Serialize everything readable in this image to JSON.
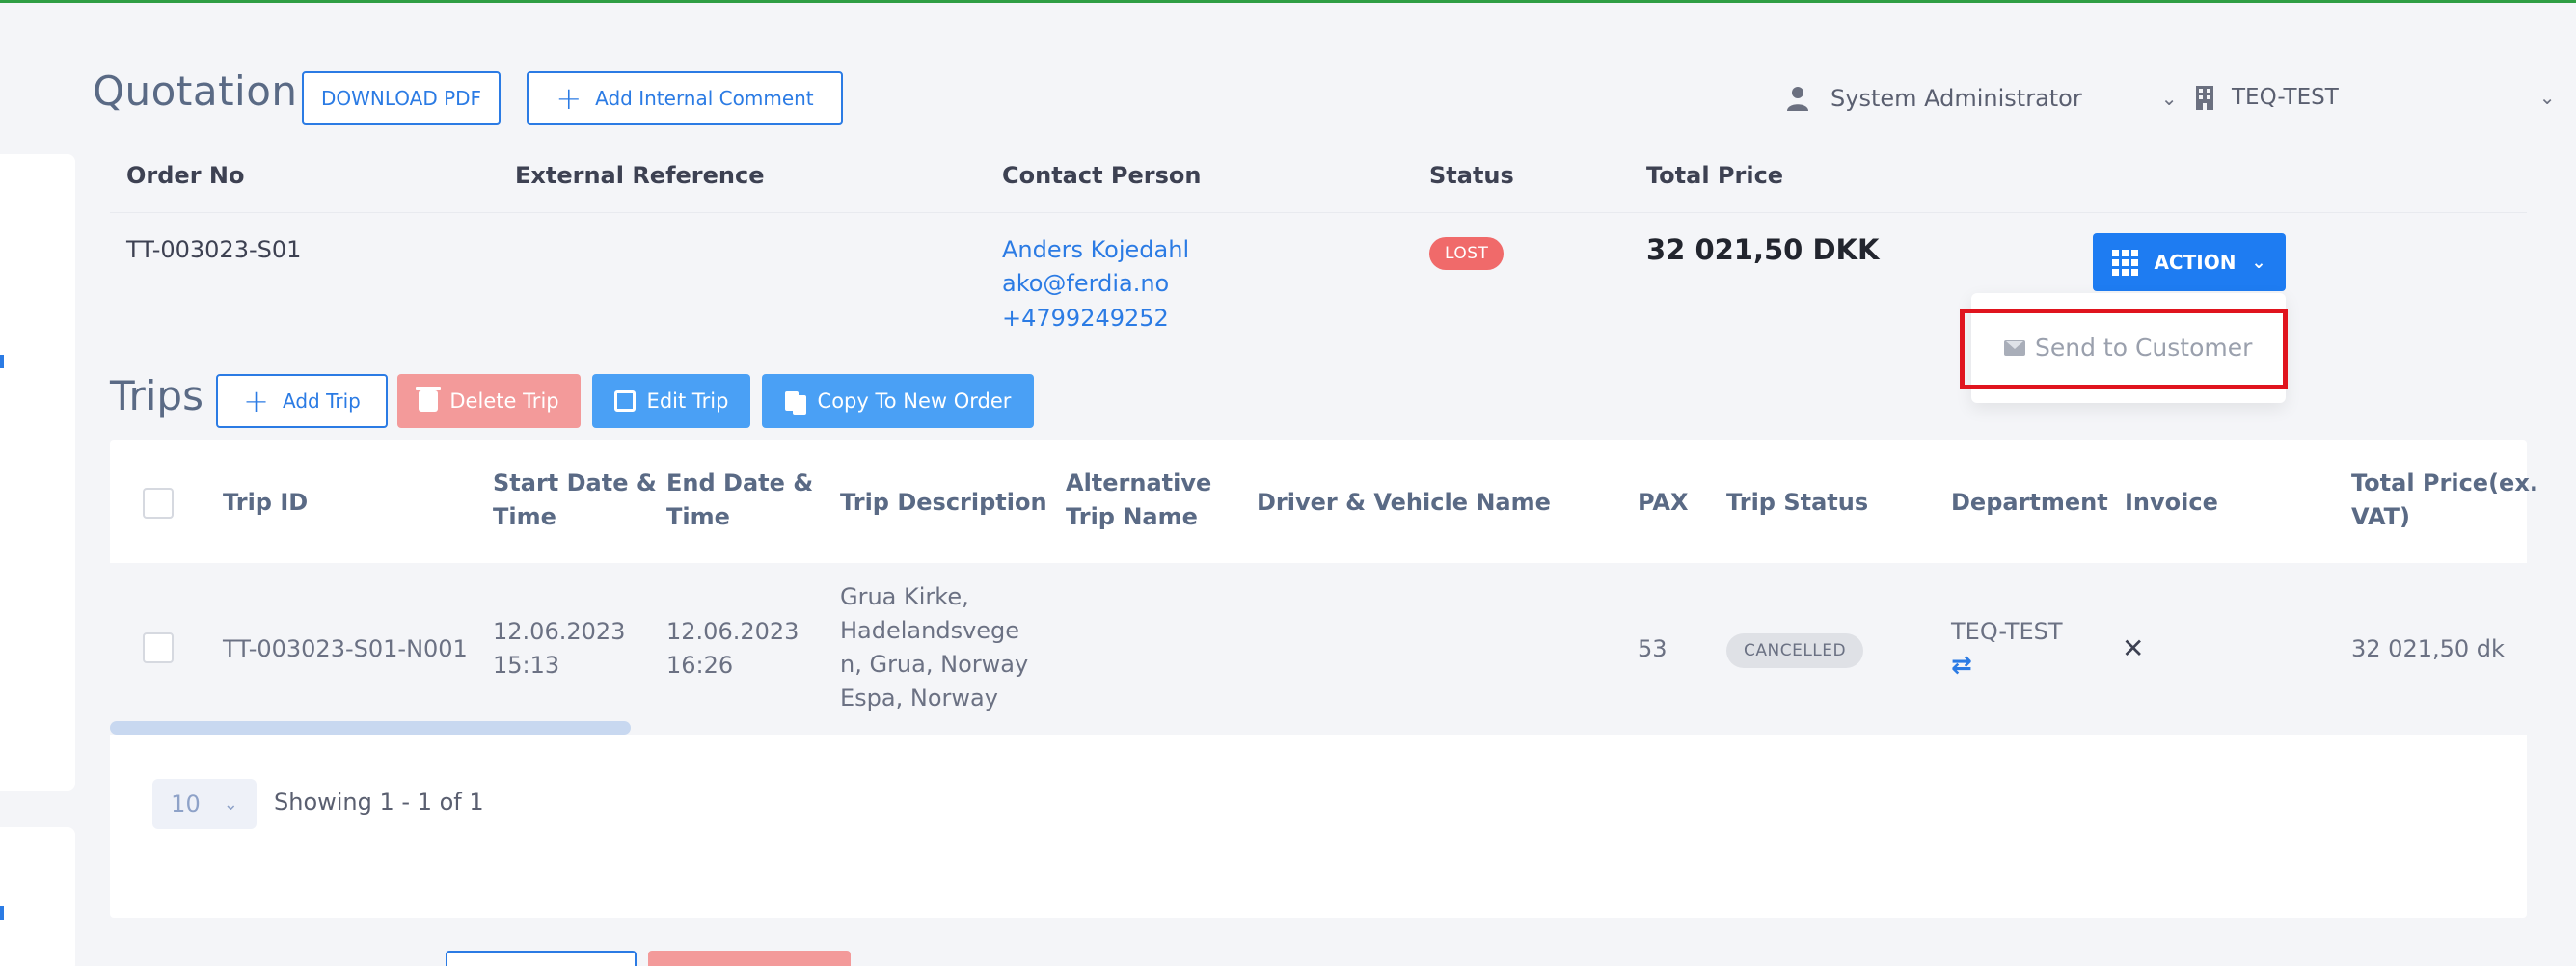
{
  "header": {
    "title": "Quotation",
    "download_pdf": "DOWNLOAD PDF",
    "add_comment": "Add Internal Comment",
    "user": "System Administrator",
    "company": "TEQ-TEST"
  },
  "order": {
    "labels": {
      "order_no": "Order No",
      "external_reference": "External Reference",
      "contact_person": "Contact Person",
      "status": "Status",
      "total_price": "Total Price"
    },
    "order_no": "TT-003023-S01",
    "contact_name": "Anders Kojedahl",
    "contact_email": "ako@ferdia.no",
    "contact_phone": "+4799249252",
    "status": "LOST",
    "total_price": "32 021,50 DKK",
    "action_label": "ACTION",
    "action_menu": [
      "Send to Customer"
    ]
  },
  "trips": {
    "title": "Trips",
    "buttons": {
      "add": "Add Trip",
      "delete": "Delete Trip",
      "edit": "Edit Trip",
      "copy": "Copy To New Order"
    },
    "columns": {
      "trip_id": "Trip ID",
      "start_1": "Start Date &",
      "start_2": "Time",
      "end_1": "End Date &",
      "end_2": "Time",
      "description": "Trip Description",
      "alt_1": "Alternative",
      "alt_2": "Trip Name",
      "driver": "Driver & Vehicle Name",
      "pax": "PAX",
      "trip_status": "Trip Status",
      "department": "Department",
      "invoice": "Invoice",
      "total_1": "Total Price(ex.",
      "total_2": "VAT)"
    },
    "rows": [
      {
        "trip_id": "TT-003023-S01-N001",
        "start_date": "12.06.2023",
        "start_time": "15:13",
        "end_date": "12.06.2023",
        "end_time": "16:26",
        "desc_1": "Grua Kirke,",
        "desc_2": "Hadelandsvege",
        "desc_3": "n, Grua, Norway",
        "desc_4": "Espa, Norway",
        "pax": "53",
        "trip_status": "CANCELLED",
        "department": "TEQ-TEST",
        "total": "32 021,50 dk"
      }
    ],
    "page_size": "10",
    "showing": "Showing 1 - 1 of 1"
  },
  "colors": {
    "primary": "#2b7be4",
    "action": "#1e7cf2",
    "lost": "#f06a6a",
    "highlight": "#e0141e"
  }
}
